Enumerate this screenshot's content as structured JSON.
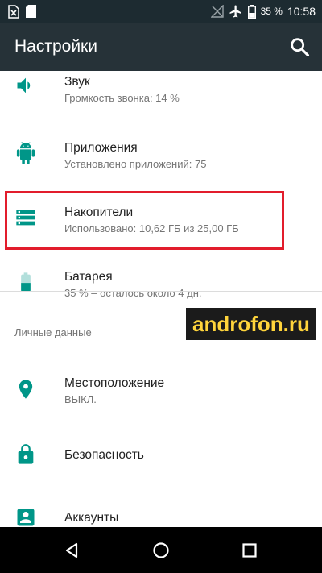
{
  "status_bar": {
    "battery_percent": "35 %",
    "time": "10:58"
  },
  "app_bar": {
    "title": "Настройки"
  },
  "items": [
    {
      "title": "Звук",
      "subtitle": "Громкость звонка: 14 %",
      "icon": "speaker-icon"
    },
    {
      "title": "Приложения",
      "subtitle": "Установлено приложений: 75",
      "icon": "android-icon"
    },
    {
      "title": "Накопители",
      "subtitle": "Использовано: 10,62 ГБ из 25,00 ГБ",
      "icon": "storage-icon"
    },
    {
      "title": "Батарея",
      "subtitle": "35 % – осталось около 4 дн.",
      "icon": "battery-icon"
    }
  ],
  "section_header": "Личные данные",
  "personal_items": [
    {
      "title": "Местоположение",
      "subtitle": "ВЫКЛ.",
      "icon": "location-pin-icon"
    },
    {
      "title": "Безопасность",
      "icon": "lock-icon"
    },
    {
      "title": "Аккаунты",
      "icon": "account-icon"
    }
  ],
  "watermark": "androfon.ru",
  "colors": {
    "accent": "#009688",
    "status_bar": "#1d2b31",
    "app_bar": "#263238",
    "highlight": "#e21d2c"
  }
}
